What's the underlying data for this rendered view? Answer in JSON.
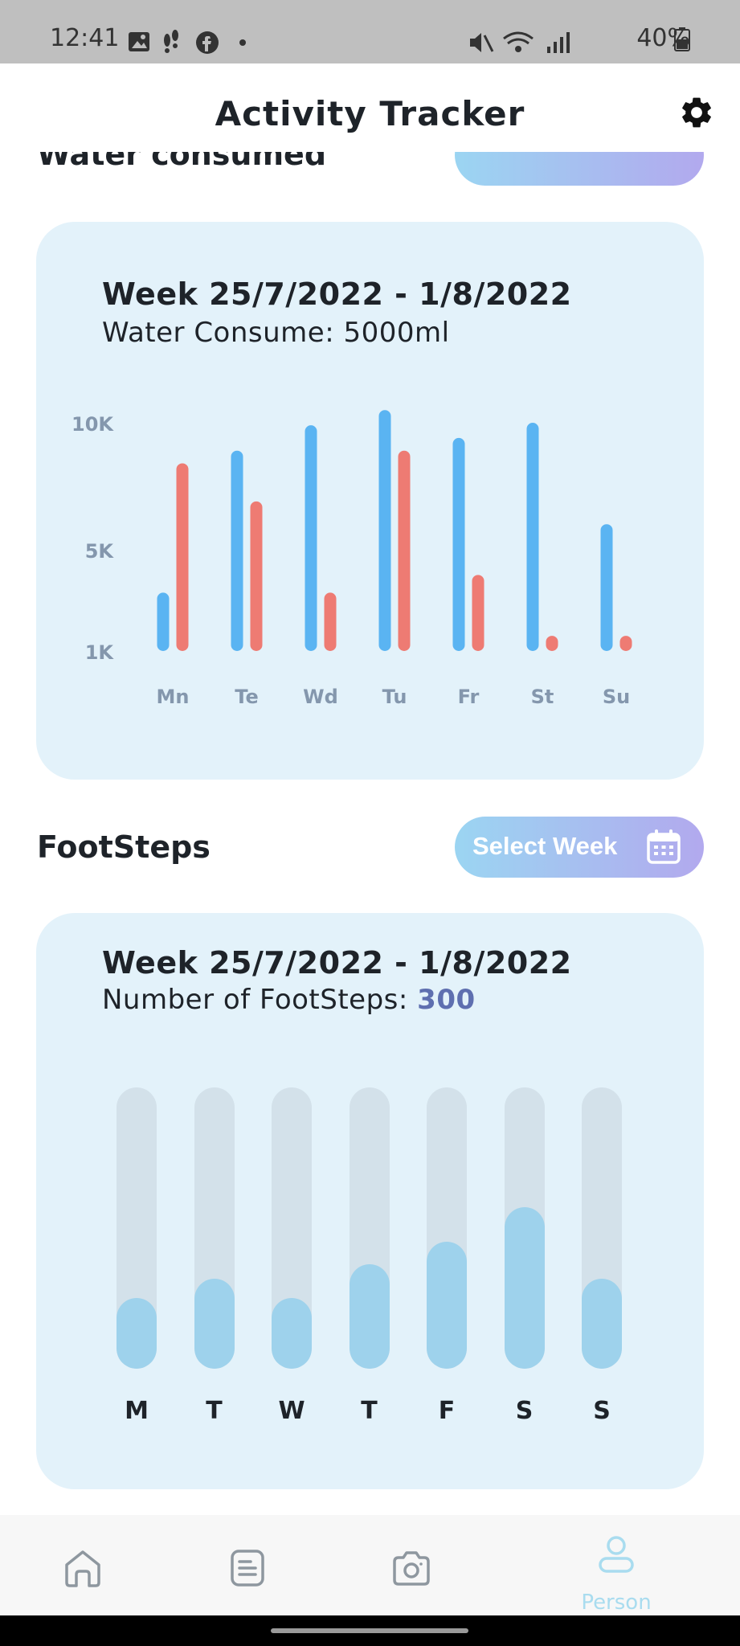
{
  "status_bar": {
    "time": "12:41",
    "battery": "40%",
    "icons": [
      "image-icon",
      "steps-icon",
      "facebook-icon",
      "dot-icon",
      "mute-icon",
      "wifi-icon",
      "signal-icon",
      "battery-icon"
    ]
  },
  "header": {
    "title": "Activity Tracker",
    "settings_icon": "gear-icon"
  },
  "partial_section": {
    "title": "Water consumed"
  },
  "water_card": {
    "week": "Week 25/7/2022 - 1/8/2022",
    "summary": "Water Consume: 5000ml",
    "chart_data": {
      "type": "bar",
      "categories": [
        "Mn",
        "Te",
        "Wd",
        "Tu",
        "Fr",
        "St",
        "Su"
      ],
      "y_ticks": [
        "10K",
        "5K",
        "1K"
      ],
      "ylim": [
        1000,
        10000
      ],
      "colors": [
        "#5ab4f2",
        "#ee7b73"
      ],
      "series": [
        {
          "values": [
            3300,
            8900,
            9900,
            10500,
            9400,
            10000,
            6000
          ]
        },
        {
          "values": [
            8400,
            6900,
            3300,
            8900,
            4000,
            1600,
            1600
          ]
        }
      ]
    }
  },
  "footsteps": {
    "section_title": "FootSteps",
    "select_week_label": "Select Week",
    "week": "Week 25/7/2022 - 1/8/2022",
    "summary_label": "Number of FootSteps:",
    "summary_value": "300",
    "chart_data": {
      "type": "bar",
      "categories": [
        "M",
        "T",
        "W",
        "T",
        "F",
        "S",
        "S"
      ],
      "values": [
        0.25,
        0.32,
        0.25,
        0.37,
        0.45,
        0.575,
        0.32
      ],
      "value_unit": "fraction of track"
    }
  },
  "bottom_nav": {
    "items": [
      {
        "icon": "home-icon",
        "label": "",
        "active": false
      },
      {
        "icon": "document-icon",
        "label": "",
        "active": false
      },
      {
        "icon": "camera-icon",
        "label": "",
        "active": false
      },
      {
        "icon": "person-icon",
        "label": "Person",
        "active": true
      }
    ]
  }
}
